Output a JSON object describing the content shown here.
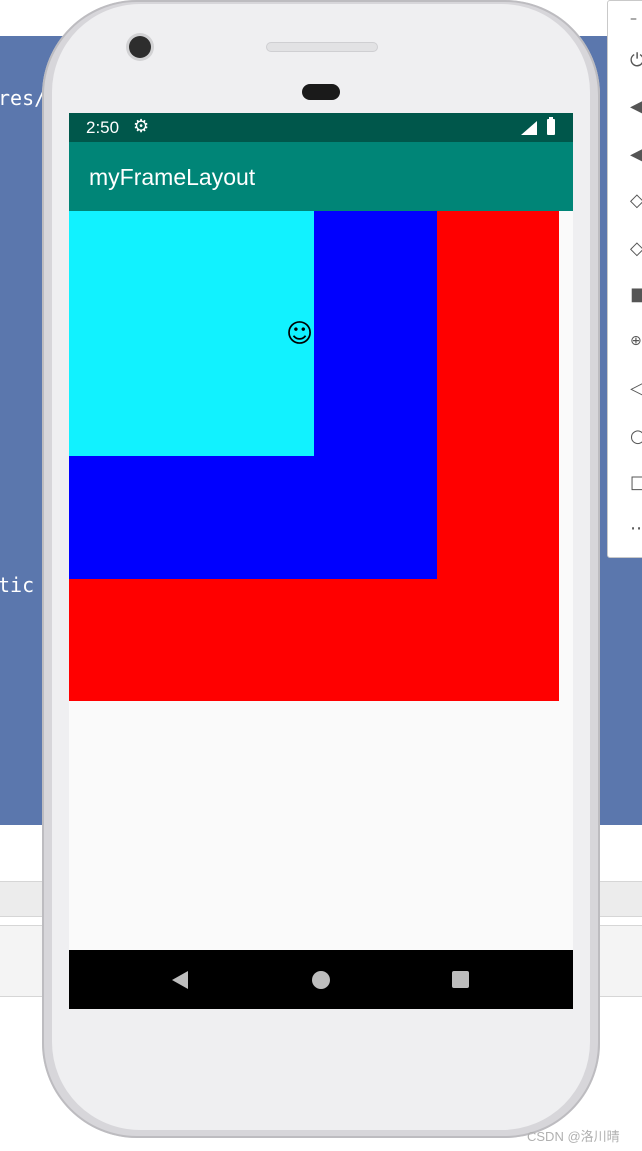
{
  "ide": {
    "code_fragment_1": "res/",
    "code_fragment_2": "tic"
  },
  "side_toolbar": {
    "icons": [
      "minimize-icon",
      "power-icon",
      "volume-up-icon",
      "volume-down-icon",
      "rotate-left-icon",
      "rotate-right-icon",
      "camera-icon",
      "zoom-icon",
      "back-icon",
      "home-icon",
      "overview-icon",
      "more-icon"
    ]
  },
  "status_bar": {
    "time": "2:50",
    "color": "#00574b"
  },
  "app_bar": {
    "title": "myFrameLayout",
    "color": "#008577"
  },
  "frame_layout": {
    "layers": [
      {
        "name": "red",
        "color": "#ff0000"
      },
      {
        "name": "blue",
        "color": "#0000ff"
      },
      {
        "name": "cyan",
        "color": "#11f2ff"
      }
    ],
    "foreground_glyph": "☺"
  },
  "nav_bar": {
    "buttons": [
      "back-icon",
      "home-icon",
      "recents-icon"
    ]
  },
  "watermark": "CSDN @洛川晴"
}
